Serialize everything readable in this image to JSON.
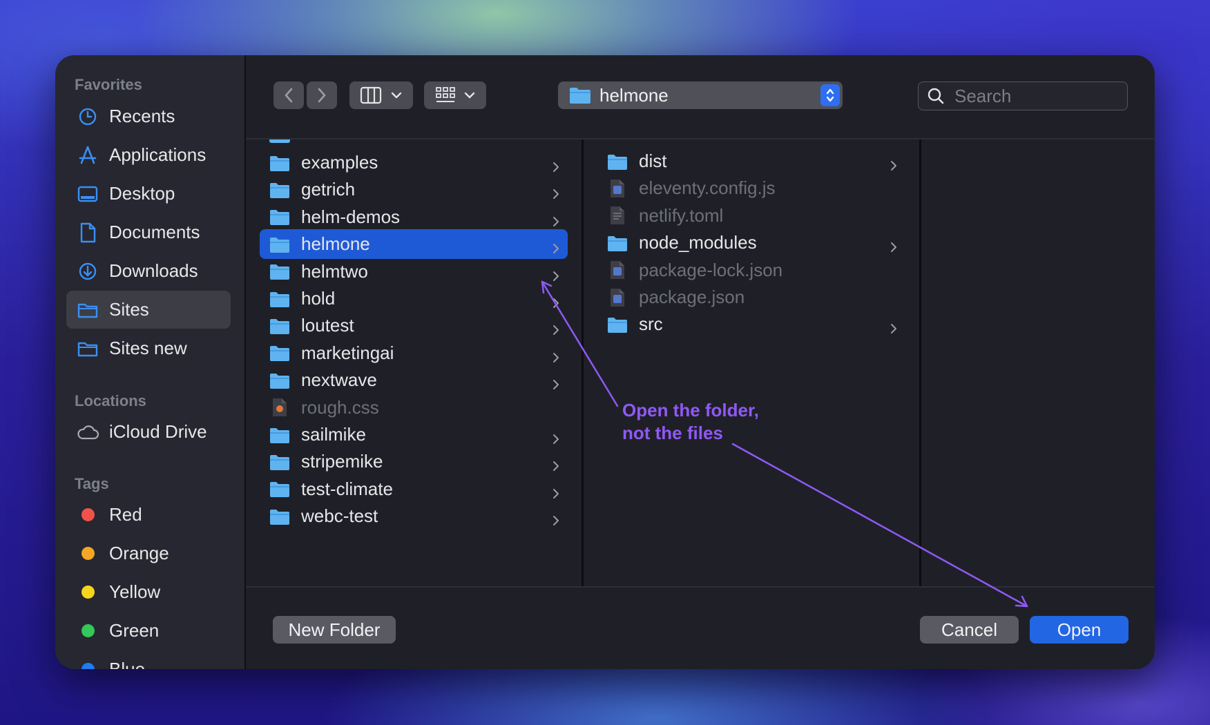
{
  "sidebar": {
    "favorites_title": "Favorites",
    "favorites": [
      {
        "label": "Recents",
        "icon": "clock-icon"
      },
      {
        "label": "Applications",
        "icon": "applications-icon"
      },
      {
        "label": "Desktop",
        "icon": "desktop-icon"
      },
      {
        "label": "Documents",
        "icon": "document-icon"
      },
      {
        "label": "Downloads",
        "icon": "download-icon"
      },
      {
        "label": "Sites",
        "icon": "folder-icon",
        "selected": true
      },
      {
        "label": "Sites new",
        "icon": "folder-icon"
      }
    ],
    "locations_title": "Locations",
    "locations": [
      {
        "label": "iCloud Drive",
        "icon": "cloud-icon"
      }
    ],
    "tags_title": "Tags",
    "tags": [
      {
        "label": "Red",
        "color": "#f0524a"
      },
      {
        "label": "Orange",
        "color": "#f5a623"
      },
      {
        "label": "Yellow",
        "color": "#f7d51c"
      },
      {
        "label": "Green",
        "color": "#34c759"
      },
      {
        "label": "Blue",
        "color": "#1f7cf2"
      }
    ]
  },
  "toolbar": {
    "path_label": "helmone",
    "search_placeholder": "Search"
  },
  "column1": [
    {
      "label": "examples",
      "type": "folder"
    },
    {
      "label": "getrich",
      "type": "folder"
    },
    {
      "label": "helm-demos",
      "type": "folder"
    },
    {
      "label": "helmone",
      "type": "folder",
      "selected": true
    },
    {
      "label": "helmtwo",
      "type": "folder"
    },
    {
      "label": "hold",
      "type": "folder"
    },
    {
      "label": "loutest",
      "type": "folder"
    },
    {
      "label": "marketingai",
      "type": "folder"
    },
    {
      "label": "nextwave",
      "type": "folder"
    },
    {
      "label": "rough.css",
      "type": "file"
    },
    {
      "label": "sailmike",
      "type": "folder"
    },
    {
      "label": "stripemike",
      "type": "folder"
    },
    {
      "label": "test-climate",
      "type": "folder"
    },
    {
      "label": "webc-test",
      "type": "folder"
    }
  ],
  "column2": [
    {
      "label": "dist",
      "type": "folder"
    },
    {
      "label": "eleventy.config.js",
      "type": "file"
    },
    {
      "label": "netlify.toml",
      "type": "file"
    },
    {
      "label": "node_modules",
      "type": "folder"
    },
    {
      "label": "package-lock.json",
      "type": "file"
    },
    {
      "label": "package.json",
      "type": "file"
    },
    {
      "label": "src",
      "type": "folder"
    }
  ],
  "footer": {
    "new_folder": "New Folder",
    "cancel": "Cancel",
    "open": "Open"
  },
  "annotation": {
    "line1": "Open the folder,",
    "line2": "not the files",
    "color": "#8f59f5"
  },
  "colors": {
    "accent": "#1f5ad6",
    "folder": "#5fb3f0"
  }
}
